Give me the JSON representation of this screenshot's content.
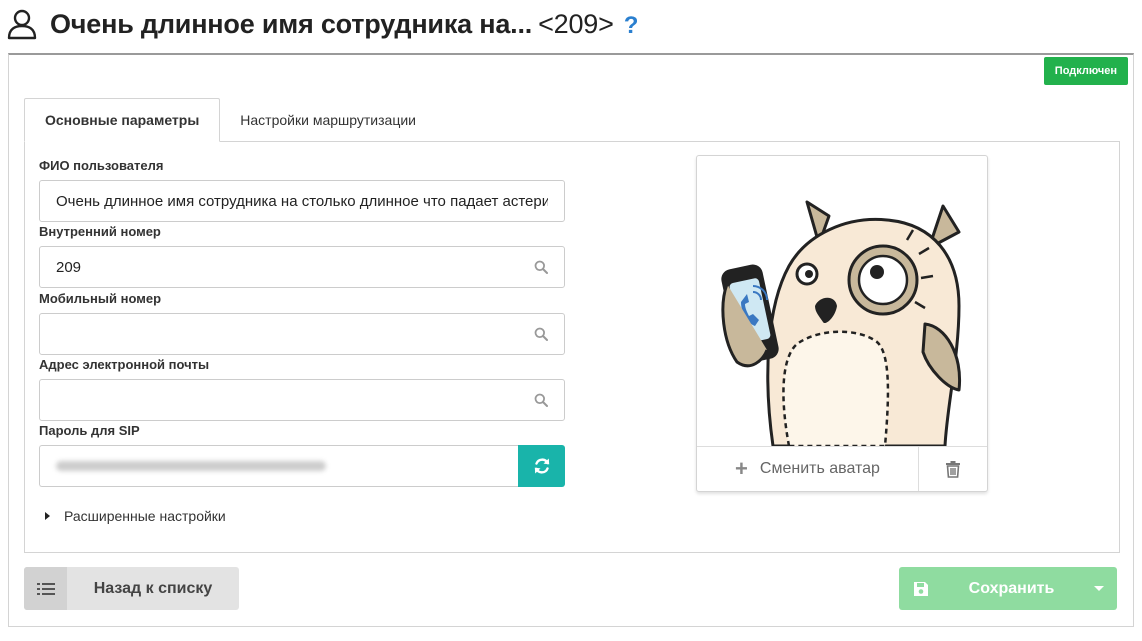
{
  "header": {
    "title": "Очень длинное имя сотрудника на...",
    "extension": "<209>",
    "help_symbol": "?",
    "user_icon": "user-icon",
    "help_color": "#2a7fcf"
  },
  "status_badge": {
    "label": "Подключен",
    "color": "#22b14c"
  },
  "tabs": [
    {
      "label": "Основные параметры",
      "active": true
    },
    {
      "label": "Настройки маршрутизации",
      "active": false
    }
  ],
  "form": {
    "fio": {
      "label": "ФИО пользователя",
      "value": "Очень длинное имя сотрудника на столько длинное  что падает астерикс"
    },
    "internal_number": {
      "label": "Внутренний номер",
      "value": "209",
      "icon": "search-icon"
    },
    "mobile_number": {
      "label": "Мобильный номер",
      "value": "",
      "icon": "search-icon"
    },
    "email": {
      "label": "Адрес электронной почты",
      "value": "",
      "icon": "search-icon"
    },
    "sip_password": {
      "label": "Пароль для SIP",
      "value": "",
      "icon": "refresh-icon",
      "button_color": "#19b4aa"
    },
    "advanced_label": "Расширенные настройки"
  },
  "avatar": {
    "change_label": "Сменить аватар",
    "change_icon": "plus-icon",
    "delete_icon": "trash-icon"
  },
  "footer": {
    "back_label": "Назад к списку",
    "back_icon": "list-icon",
    "save_label": "Сохранить",
    "save_icon": "floppy-disk-icon",
    "save_color": "#8fdca0"
  }
}
